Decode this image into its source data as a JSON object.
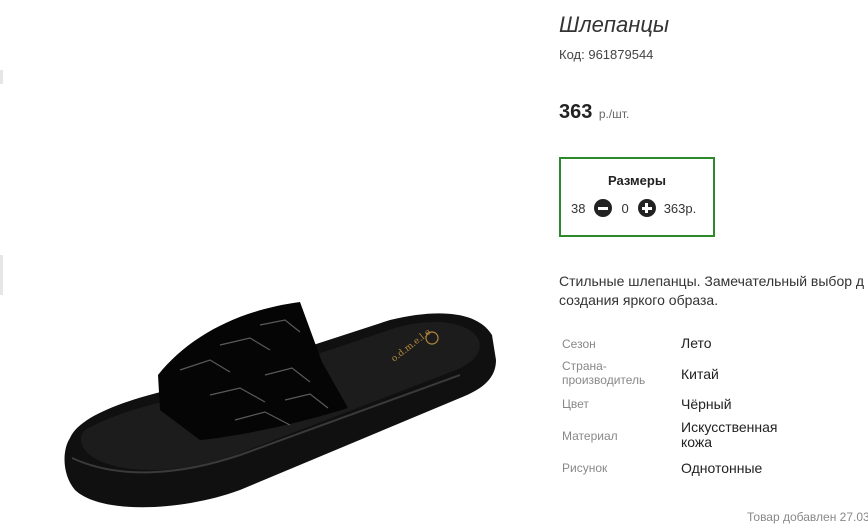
{
  "product": {
    "title": "Шлепанцы",
    "code_label": "Код:",
    "code_value": "961879544",
    "price_value": "363",
    "price_unit": "р./шт.",
    "brand_mark": "o.d.m.e.l.e"
  },
  "sizes": {
    "title": "Размеры",
    "rows": [
      {
        "size": "38",
        "quantity": "0",
        "price": "363р."
      }
    ]
  },
  "description": {
    "line1": "Стильные шлепанцы. Замечательный выбор д",
    "line2": "создания яркого образа."
  },
  "properties": [
    {
      "name": "Сезон",
      "value": "Лето"
    },
    {
      "name": "Страна-производитель",
      "value": "Китай"
    },
    {
      "name": "Цвет",
      "value": "Чёрный"
    },
    {
      "name": "Материал",
      "value": "Искусственная кожа"
    },
    {
      "name": "Рисунок",
      "value": "Однотонные"
    }
  ],
  "footer": {
    "added_text": "Товар добавлен 27.03"
  },
  "colors": {
    "sizes_border": "#2c8a2c",
    "slipper": "#0e0e0e",
    "insole_text": "#b48a3c"
  }
}
